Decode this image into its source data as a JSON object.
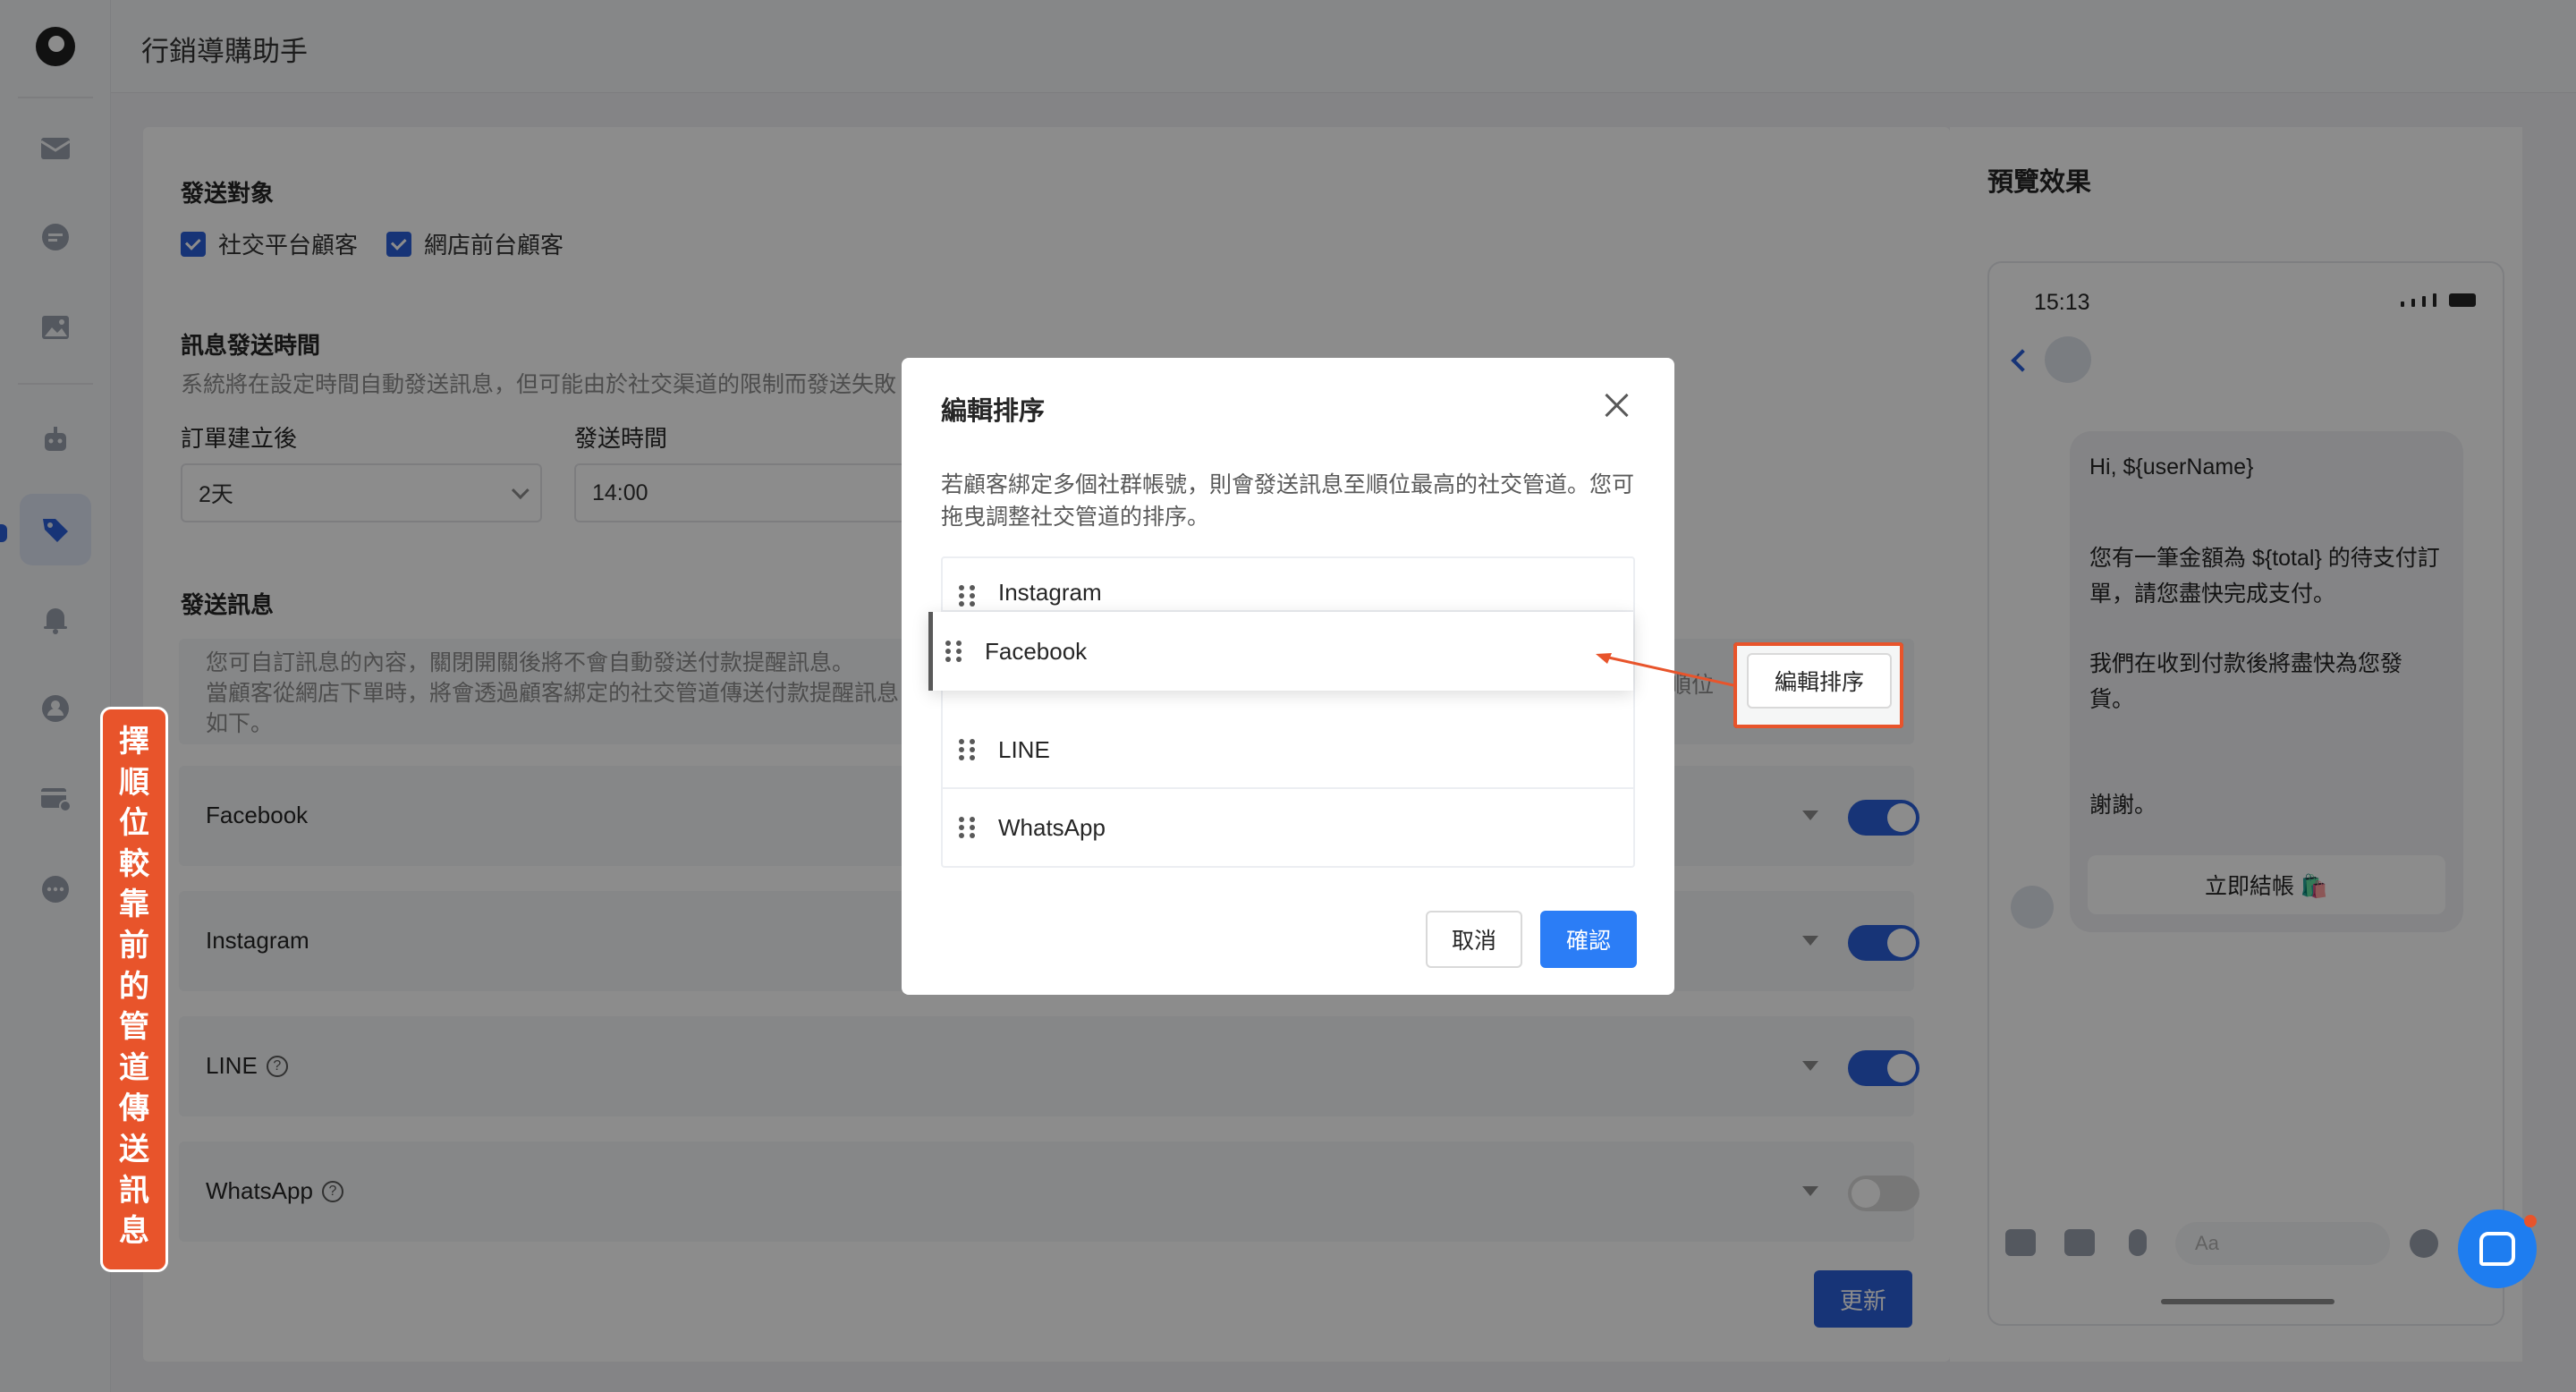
{
  "app": {
    "title": "行銷導購助手"
  },
  "sidebar": {
    "icons": [
      "logo-icon",
      "inbox-icon",
      "chat-icon",
      "image-icon",
      "robot-icon",
      "tag-icon",
      "bell-icon",
      "contacts-icon",
      "card-icon",
      "more-icon"
    ],
    "active": "tag-icon"
  },
  "form": {
    "target": {
      "title": "發送對象",
      "options": [
        {
          "label": "社交平台顧客",
          "checked": true
        },
        {
          "label": "網店前台顧客",
          "checked": true
        }
      ]
    },
    "schedule": {
      "title": "訊息發送時間",
      "desc": "系統將在設定時間自動發送訊息，但可能由於社交渠道的限制而發送失敗",
      "after_label": "訂單建立後",
      "after_value": "2天",
      "time_label": "發送時間",
      "time_value": "14:00"
    },
    "message": {
      "title": "發送訊息",
      "info_line1": "您可自訂訊息的內容，關閉開關後將不會自動發送付款提醒訊息。",
      "info_line2": "當顧客從網店下單時，將會透過顧客綁定的社交管道傳送付款提醒訊息",
      "info_line3": "如下。",
      "info_right": "順位",
      "sort_button": "編輯排序"
    },
    "channels": [
      {
        "name": "Facebook",
        "help": false,
        "enabled": true
      },
      {
        "name": "Instagram",
        "help": false,
        "enabled": true
      },
      {
        "name": "LINE",
        "help": true,
        "enabled": true
      },
      {
        "name": "WhatsApp",
        "help": true,
        "enabled": false
      }
    ],
    "update_button": "更新"
  },
  "preview": {
    "title": "預覽效果",
    "time": "15:13",
    "greeting": "Hi, ${userName}",
    "body1": "您有一筆金額為 ${total} 的待支付訂單，請您盡快完成支付。",
    "body2": "我們在收到付款後將盡快為您發貨。",
    "thanks": "謝謝。",
    "checkout_button": "立即結帳 🛍️",
    "input_placeholder": "Aa"
  },
  "modal": {
    "title": "編輯排序",
    "desc": "若顧客綁定多個社群帳號，則會發送訊息至順位最高的社交管道。您可拖曳調整社交管道的排序。",
    "items": [
      "Instagram",
      "LINE",
      "WhatsApp"
    ],
    "dragging_item": "Facebook",
    "cancel": "取消",
    "confirm": "確認"
  },
  "annotation": {
    "vertical_text": "擇順位較靠前的管道傳送訊息",
    "highlight_color": "#e8542b"
  }
}
